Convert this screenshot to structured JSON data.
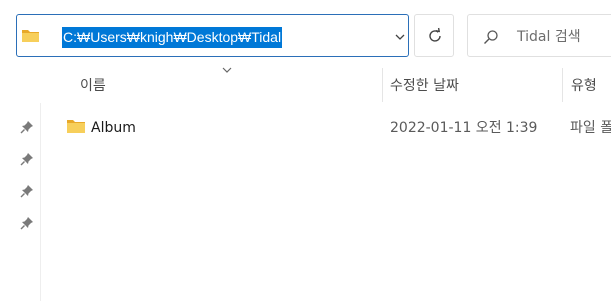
{
  "address_bar": {
    "path": "C:₩Users₩knigh₩Desktop₩Tidal",
    "folder_icon": "folder-icon",
    "dropdown_icon": "chevron-down-icon"
  },
  "refresh": {
    "icon": "refresh-icon"
  },
  "search": {
    "icon": "search-icon",
    "placeholder": "Tidal 검색"
  },
  "columns": {
    "name": "이름",
    "date_modified": "수정한 날짜",
    "type": "유형"
  },
  "quick_access_pins": [
    "pin-icon",
    "pin-icon",
    "pin-icon",
    "pin-icon"
  ],
  "files": [
    {
      "name": "Album",
      "date_modified": "2022-01-11 오전 1:39",
      "type": "파일 폴"
    }
  ],
  "colors": {
    "selection": "#0078d7",
    "folder": "#f4c542",
    "border_focus": "#2b6fb8"
  }
}
